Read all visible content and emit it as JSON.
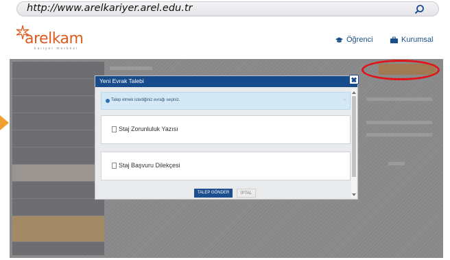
{
  "browser": {
    "url": "http://www.arelkariyer.arel.edu.tr"
  },
  "header": {
    "logo_text": "arelkam",
    "logo_subtext": "kariyer merkezi",
    "nav": [
      {
        "label": "Öğrenci",
        "icon": "graduation-cap-icon"
      },
      {
        "label": "Kurumsal",
        "icon": "briefcase-icon"
      }
    ]
  },
  "colors": {
    "brand_orange": "#e05a1e",
    "modal_blue": "#184b8c",
    "annotation_red": "#e0141a",
    "arrow_orange": "#f0a030"
  },
  "modal": {
    "title": "Yeni Evrak Talebi",
    "info_text": "Talep etmek istediğiniz evrağı seçiniz.",
    "documents": [
      {
        "label": "Staj Zorunluluk Yazısı"
      },
      {
        "label": "Staj Başvuru Dilekçesi"
      }
    ],
    "submit_label": "TALEP GÖNDER",
    "cancel_label": "İPTAL"
  }
}
